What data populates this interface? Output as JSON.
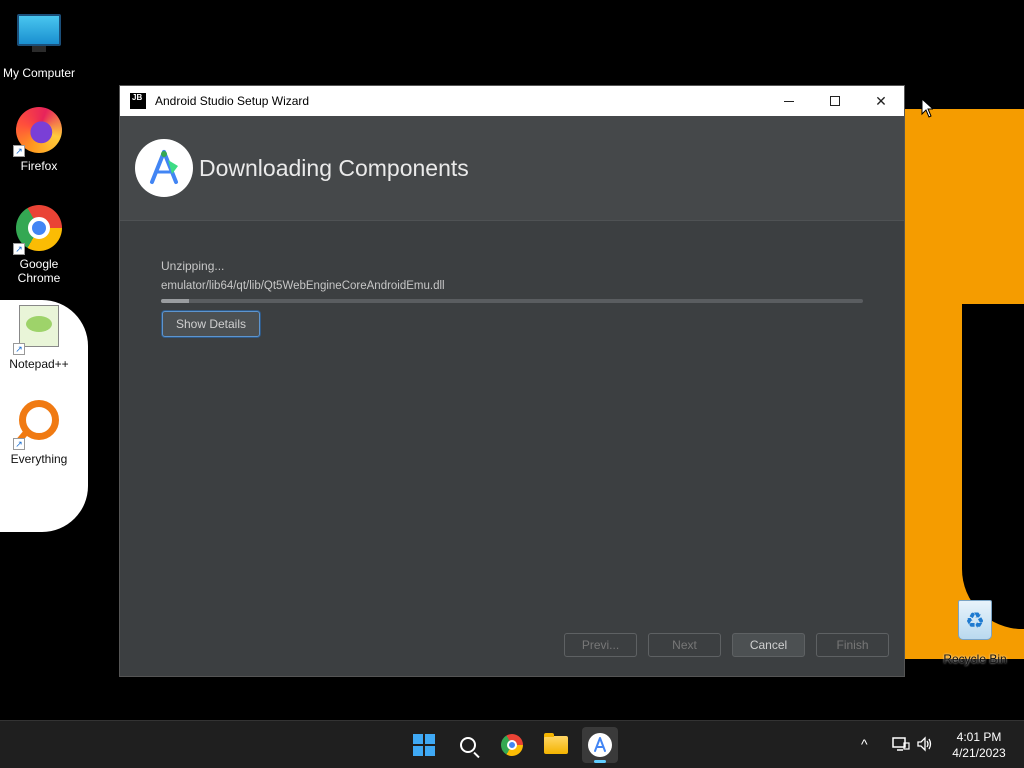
{
  "desktop": {
    "icons": [
      {
        "label": "My Computer"
      },
      {
        "label": "Firefox"
      },
      {
        "label": "Google Chrome"
      },
      {
        "label": "Notepad++"
      },
      {
        "label": "Everything"
      },
      {
        "label": "Recycle Bin"
      }
    ]
  },
  "window": {
    "title": "Android Studio Setup Wizard",
    "logo_text": "JB",
    "controls": {
      "minimize": "minimize",
      "maximize": "maximize",
      "close": "✕"
    }
  },
  "wizard": {
    "heading": "Downloading Components",
    "status": "Unzipping...",
    "current_file": "emulator/lib64/qt/lib/Qt5WebEngineCoreAndroidEmu.dll",
    "progress_fraction": 0.04,
    "show_details_label": "Show Details",
    "footer": {
      "previous_label": "Previ...",
      "next_label": "Next",
      "cancel_label": "Cancel",
      "finish_label": "Finish"
    }
  },
  "taskbar": {
    "apps": [
      "start-icon",
      "search-icon",
      "chrome-icon",
      "file-explorer-icon",
      "android-studio-icon"
    ],
    "tray": {
      "chevron": "^",
      "time": "4:01 PM",
      "date": "4/21/2023"
    }
  },
  "colors": {
    "window_bg": "#3c3f41",
    "header_bg": "#45484a",
    "accent": "#5d95cf",
    "orange": "#f59c00"
  }
}
